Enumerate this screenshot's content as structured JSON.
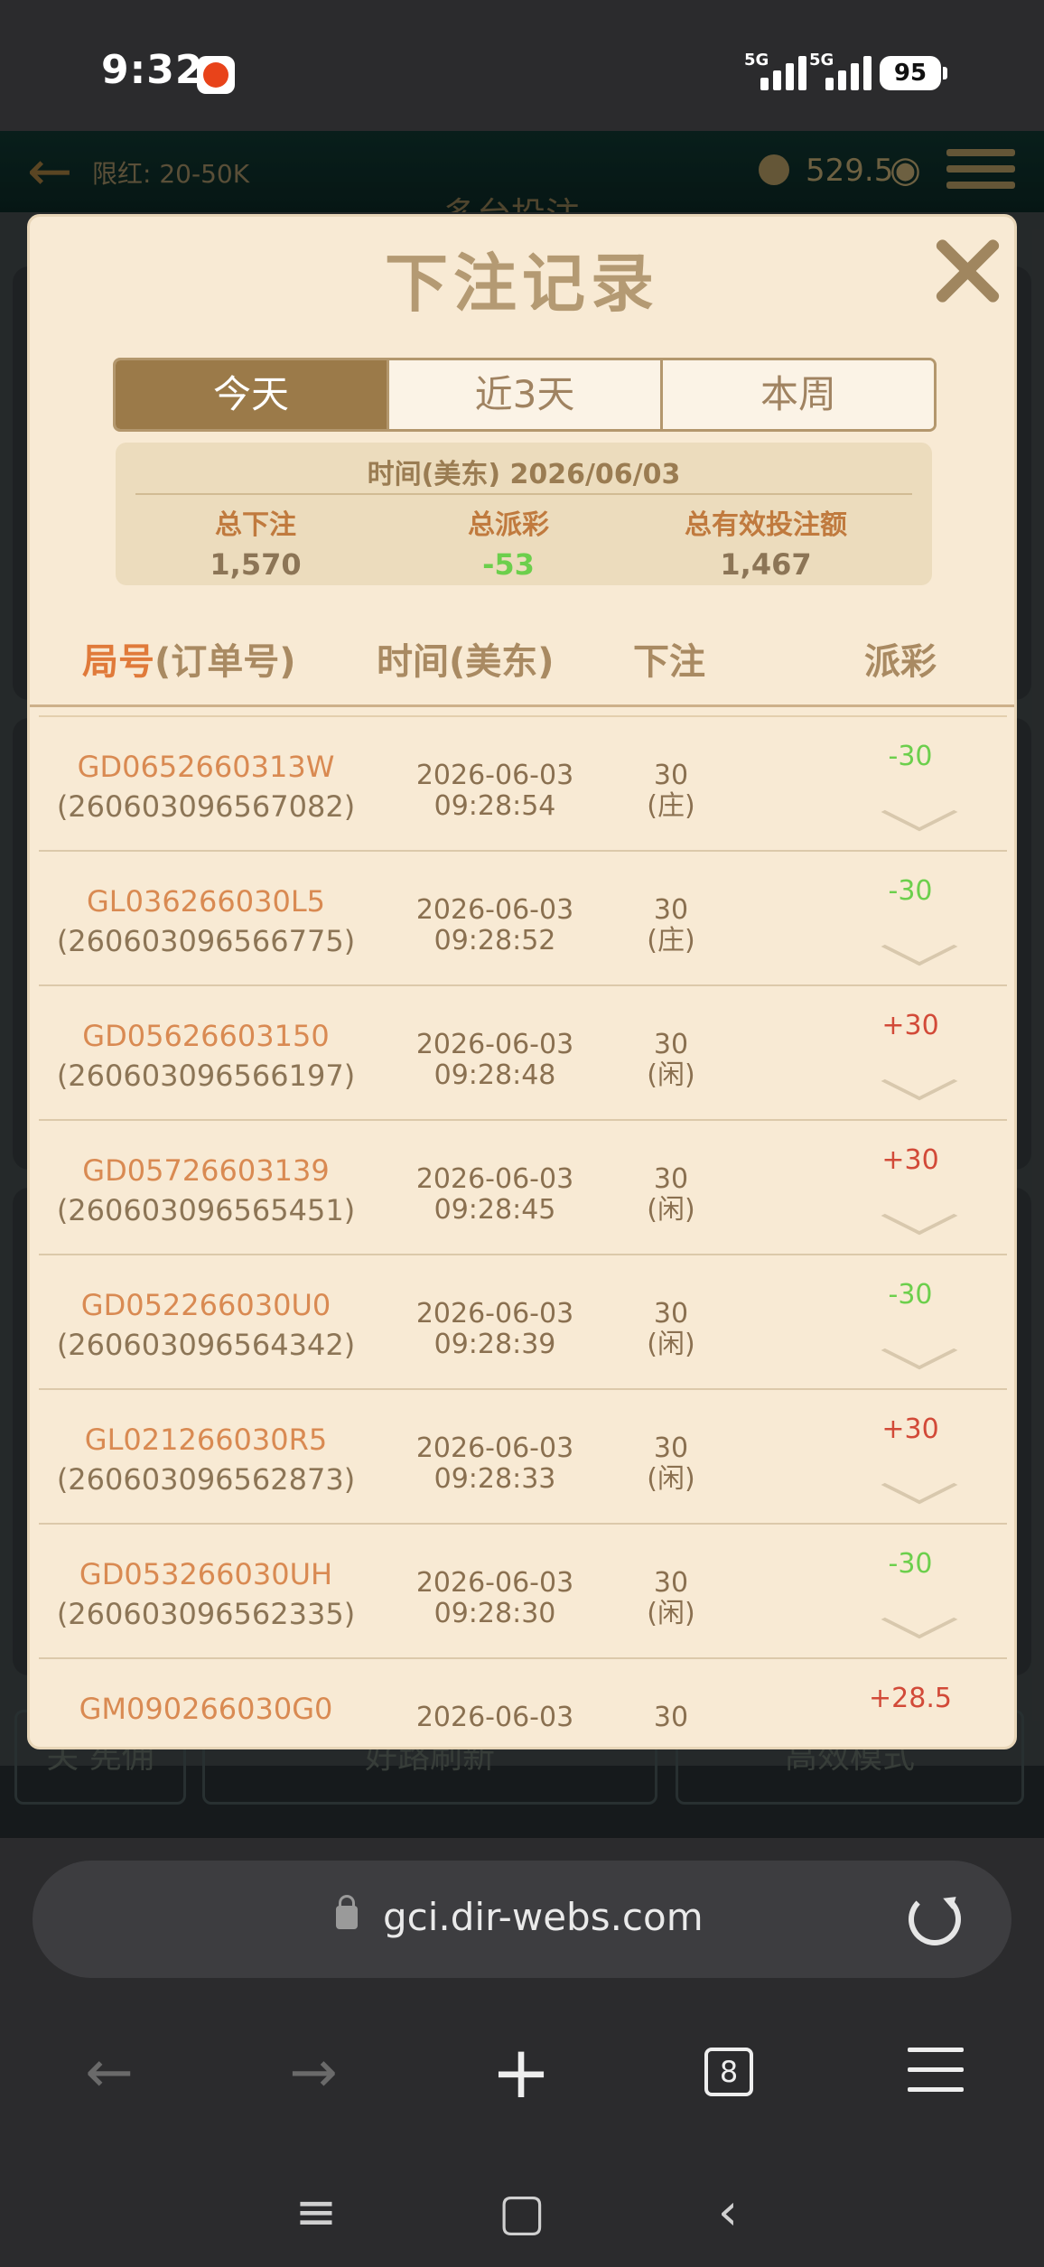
{
  "status_bar": {
    "time": "9:32",
    "network_1": "5G",
    "network_2": "5G",
    "battery": "95"
  },
  "game_header": {
    "limit": "限红: 20-50K",
    "balance": "529.5",
    "subtitle": "多台投注"
  },
  "game_footer": {
    "toggle_label": "关",
    "toggle_text": "宪佣",
    "refresh_button": "好路刷新",
    "mode_button": "高效模式"
  },
  "modal": {
    "title": "下注记录",
    "tabs": [
      {
        "label": "今天",
        "active": true
      },
      {
        "label": "近3天",
        "active": false
      },
      {
        "label": "本周",
        "active": false
      }
    ],
    "summary": {
      "date_line": "时间(美东) 2026/06/03",
      "total_bet_label": "总下注",
      "total_bet_value": "1,570",
      "total_payout_label": "总派彩",
      "total_payout_value": "-53",
      "total_valid_label": "总有效投注额",
      "total_valid_value": "1,467"
    },
    "table_headers": {
      "round": "局号",
      "order": "(订单号)",
      "time": "时间(美东)",
      "bet": "下注",
      "payout": "派彩"
    },
    "rows": [
      {
        "round": "GD0652660313W",
        "order": "(260603096567082)",
        "date": "2026-06-03",
        "time": "09:28:54",
        "bet": "30",
        "side": "(庄)",
        "payout": "-30",
        "sign": "neg"
      },
      {
        "round": "GL036266030L5",
        "order": "(260603096566775)",
        "date": "2026-06-03",
        "time": "09:28:52",
        "bet": "30",
        "side": "(庄)",
        "payout": "-30",
        "sign": "neg"
      },
      {
        "round": "GD05626603150",
        "order": "(260603096566197)",
        "date": "2026-06-03",
        "time": "09:28:48",
        "bet": "30",
        "side": "(闲)",
        "payout": "+30",
        "sign": "pos"
      },
      {
        "round": "GD05726603139",
        "order": "(260603096565451)",
        "date": "2026-06-03",
        "time": "09:28:45",
        "bet": "30",
        "side": "(闲)",
        "payout": "+30",
        "sign": "pos"
      },
      {
        "round": "GD052266030U0",
        "order": "(260603096564342)",
        "date": "2026-06-03",
        "time": "09:28:39",
        "bet": "30",
        "side": "(闲)",
        "payout": "-30",
        "sign": "neg"
      },
      {
        "round": "GL021266030R5",
        "order": "(260603096562873)",
        "date": "2026-06-03",
        "time": "09:28:33",
        "bet": "30",
        "side": "(闲)",
        "payout": "+30",
        "sign": "pos"
      },
      {
        "round": "GD053266030UH",
        "order": "(260603096562335)",
        "date": "2026-06-03",
        "time": "09:28:30",
        "bet": "30",
        "side": "(闲)",
        "payout": "-30",
        "sign": "neg"
      },
      {
        "round": "GM090266030G0",
        "order": "",
        "date": "2026-06-03",
        "time": "",
        "bet": "30",
        "side": "",
        "payout": "+28.5",
        "sign": "pos"
      }
    ]
  },
  "browser": {
    "url": "gci.dir-webs.com",
    "tab_count": "8"
  },
  "colors": {
    "accent": "#9b7a49",
    "negative_payout": "#6ccf4c",
    "positive_payout": "#d24a38",
    "modal_bg": "#f8ead4"
  }
}
